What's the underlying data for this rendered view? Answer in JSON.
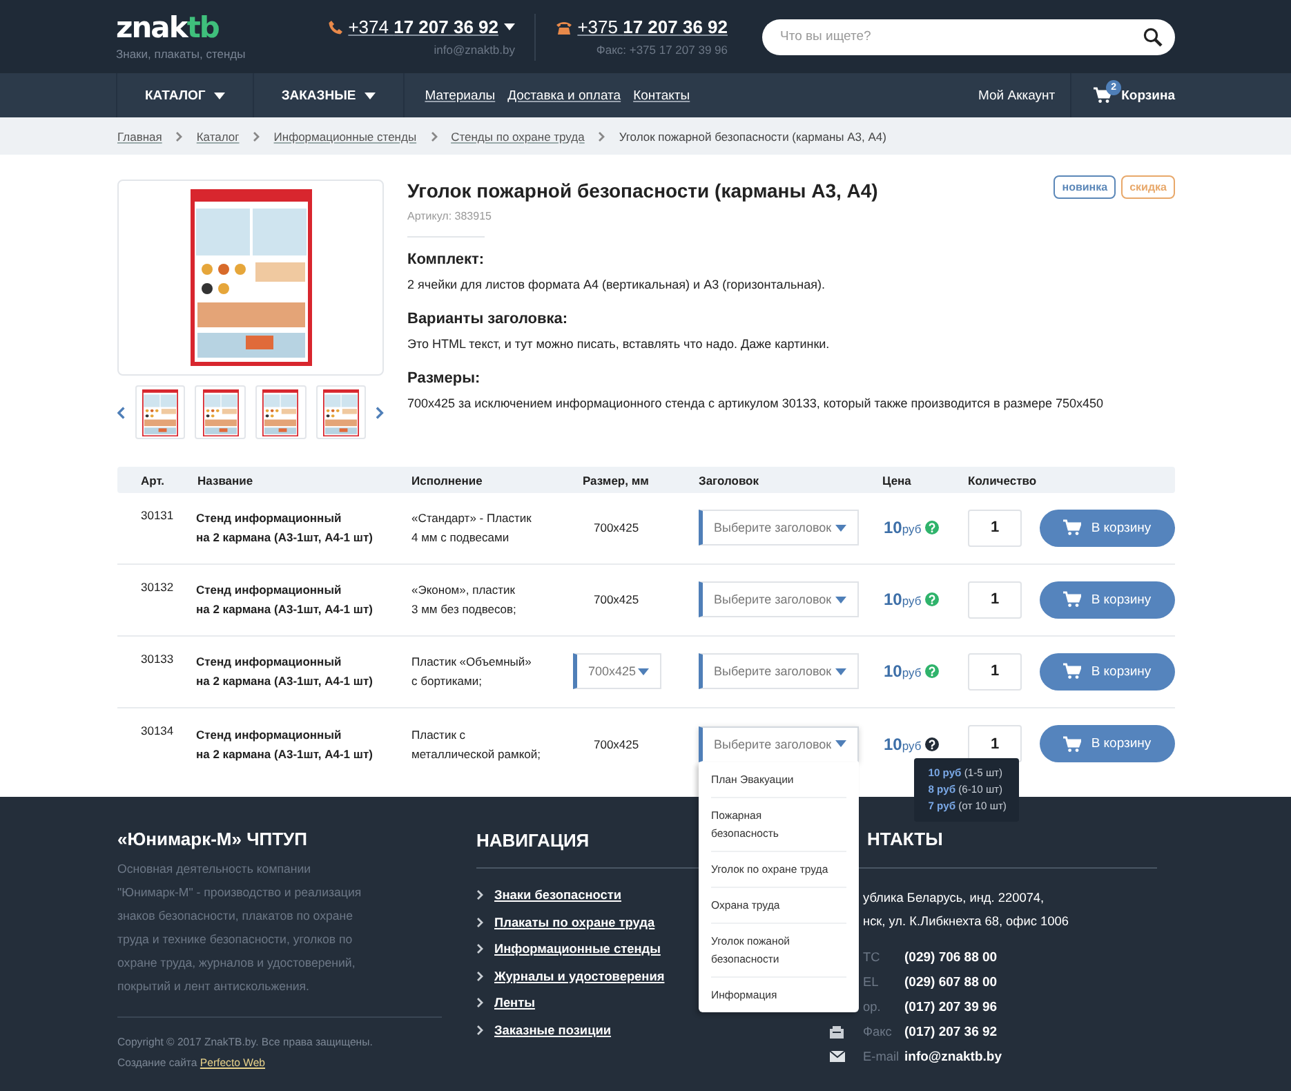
{
  "header": {
    "logo": {
      "text": "znak",
      "accent": "tb"
    },
    "tagline": "Знаки, плакаты, стенды",
    "contacts": [
      {
        "phone": "+374 **17 207 36 92**",
        "note": "info@znaktb.by",
        "dropdown": true
      },
      {
        "phone": "+375 **17 207 36 92**",
        "note": "Факс: +375 17 207 39 96",
        "dropdown": false
      }
    ],
    "search": {
      "placeholder": "Что вы ищете?"
    }
  },
  "nav": {
    "items": [
      {
        "label": "КАТАЛОГ",
        "kind": "menu"
      },
      {
        "label": "ЗАКАЗНЫЕ",
        "kind": "menu"
      },
      {
        "label": "Материалы",
        "kind": "link"
      },
      {
        "label": "Доставка и оплата",
        "kind": "link"
      },
      {
        "label": "Контакты",
        "kind": "link"
      }
    ],
    "account": "Мой Аккаунт",
    "cart": {
      "label": "Корзина",
      "count": "2"
    }
  },
  "breadcrumbs": [
    {
      "label": "Главная",
      "current": false
    },
    {
      "label": "Каталог",
      "current": false
    },
    {
      "label": "Информационные стенды",
      "current": false
    },
    {
      "label": "Стенды по охране труда",
      "current": false
    },
    {
      "label": "Уголок пожарной безопасности (карманы А3, А4)",
      "current": true
    }
  ],
  "product": {
    "title": "Уголок пожарной безопасности (карманы А3, А4)",
    "article": "Артикул: 383915",
    "badges": [
      {
        "label": "новинка",
        "color": "#5b87b8"
      },
      {
        "label": "скидка",
        "color": "#e8a86a"
      }
    ],
    "sections": [
      {
        "heading": "Комплект:",
        "text": "2 ячейки для листов формата А4 (вертикальная) и А3 (горизонтальная)."
      },
      {
        "heading": "Варианты заголовка:",
        "text": "Это HTML текст, и тут можно писать, вставлять что надо. Даже картинки."
      },
      {
        "heading": "Размеры:",
        "text": "700x425 за исключением информационного стенда с артикулом 30133, который также производится в размере 750x450"
      }
    ]
  },
  "table": {
    "columns": [
      "Арт.",
      "Название",
      "Исполнение",
      "Размер, мм",
      "Заголовок",
      "Цена",
      "Количество"
    ],
    "rows": [
      {
        "art": "30131",
        "name": "Стенд информационный\nна 2 кармана (А3-1шт, А4-1 шт)",
        "finish": "«Стандарт» - Пластик\n4 мм с подвесами",
        "size": {
          "kind": "text",
          "value": "700x425"
        },
        "heading": {
          "label": "Выберите заголовок",
          "open": false
        },
        "price": "10",
        "currency": "руб",
        "help_active": false,
        "quantity": "1",
        "button": "В корзину"
      },
      {
        "art": "30132",
        "name": "Стенд информационный\nна 2 кармана (А3-1шт, А4-1 шт)",
        "finish": "«Эконом», пластик\n3 мм без подвесов;",
        "size": {
          "kind": "text",
          "value": "700x425"
        },
        "heading": {
          "label": "Выберите заголовок",
          "open": false
        },
        "price": "10",
        "currency": "руб",
        "help_active": false,
        "quantity": "1",
        "button": "В корзину"
      },
      {
        "art": "30133",
        "name": "Стенд информационный\nна 2 кармана (А3-1шт, А4-1 шт)",
        "finish": "Пластик «Объемный»\nс бортиками;",
        "size": {
          "kind": "select",
          "value": "700x425"
        },
        "heading": {
          "label": "Выберите заголовок",
          "open": false
        },
        "price": "10",
        "currency": "руб",
        "help_active": false,
        "quantity": "1",
        "button": "В корзину"
      },
      {
        "art": "30134",
        "name": "Стенд информационный\nна 2 кармана (А3-1шт, А4-1 шт)",
        "finish": "Пластик с\nметаллической рамкой;",
        "size": {
          "kind": "text",
          "value": "700x425"
        },
        "heading": {
          "label": "Выберите заголовок",
          "open": true,
          "options": [
            "План Эвакуации",
            "Пожарная\nбезопасность",
            "Уголок по охране труда",
            "Охрана труда",
            "Уголок пожаной\nбезопасности",
            "Информация"
          ]
        },
        "price": "10",
        "currency": "руб",
        "help_active": true,
        "price_tooltip": [
          "**10 руб** (1-5 шт)",
          "**8 руб** (6-10 шт)",
          "**7 руб** (от 10 шт)"
        ],
        "quantity": "1",
        "button": "В корзину"
      }
    ]
  },
  "footer": {
    "company": {
      "title": "«Юнимарк-М» ЧПТУП",
      "description": "Основная деятельность компании\n\"Юнимарк-М\" - производство и реализация\nзнаков безопасности, плакатов по охране\nтруда и технике безопасности, уголков по\nохране труда, журналов и удостоверений,\nпокрытий и лент антискольжения.",
      "copyright": "Copyright © 2017 ZnakTB.by. Все права защищены.",
      "credit": "Создание сайта",
      "credit_link": "Perfecto Web"
    },
    "navigation": {
      "title": "НАВИГАЦИЯ",
      "links": [
        "Знаки безопасности",
        "Плакаты по охране труда",
        "Информационные стенды",
        "Журналы и удостоверения",
        "Ленты",
        "Заказные позиции"
      ]
    },
    "contacts": {
      "title": "НТАКТЫ",
      "address": "ублика Беларусь, инд. 220074,\nнск, ул. К.Либкнехта 68, офис 1006",
      "items": [
        {
          "kind": "covered",
          "label": "ТС",
          "value": "(029) 706 88 00"
        },
        {
          "kind": "covered",
          "label": "EL",
          "value": "(029) 607 88 00"
        },
        {
          "kind": "covered",
          "label": "ор.",
          "value": "(017) 207 39 96"
        },
        {
          "kind": "fax",
          "label": "Факс",
          "value": "(017) 207 36 92"
        },
        {
          "kind": "email",
          "label": "E-mail",
          "value": "info@znaktb.by"
        }
      ]
    }
  }
}
